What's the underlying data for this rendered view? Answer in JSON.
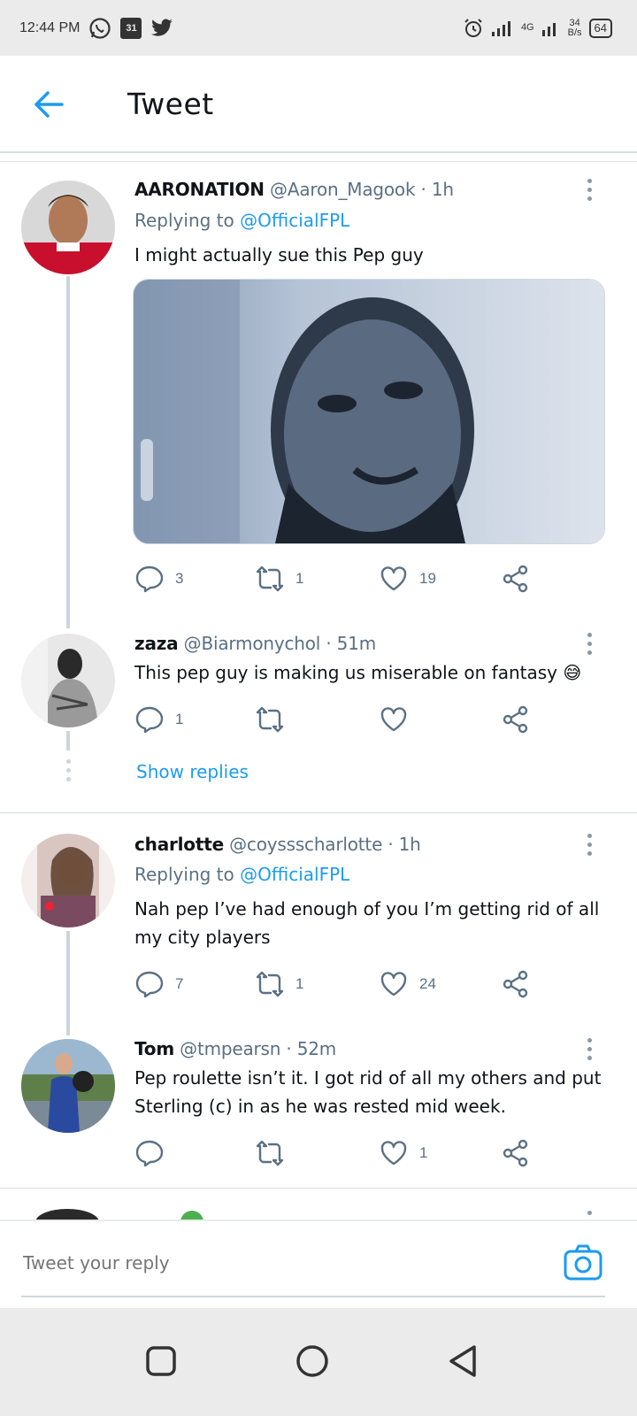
{
  "status_bar": {
    "time": "12:44 PM",
    "calendar_day": "31",
    "network_type": "4G",
    "speed_value": "34",
    "speed_unit": "B/s",
    "battery": "64",
    "icons": [
      "whatsapp-icon",
      "calendar-icon",
      "twitter-icon",
      "alarm-icon",
      "signal-icon",
      "battery-icon"
    ]
  },
  "header": {
    "title": "Tweet"
  },
  "tweets": [
    {
      "name": "AARONATION",
      "handle": "@Aaron_Magook",
      "time": "· 1h",
      "replying_label": "Replying to",
      "replying_to": "@OfficialFPL",
      "text": "I might actually sue this Pep guy",
      "replies": "3",
      "retweets": "1",
      "likes": "19"
    },
    {
      "name": "zaza",
      "handle": "@Biarmonychol",
      "time": "· 51m",
      "text": "This pep guy is making us miserable on fantasy 😅",
      "replies": "1",
      "retweets": "",
      "likes": ""
    },
    {
      "name": "charlotte",
      "handle": "@coyssscharlotte",
      "time": "· 1h",
      "replying_label": "Replying to",
      "replying_to": "@OfficialFPL",
      "text": "Nah pep I’ve had enough of you I’m getting rid of all my city players",
      "replies": "7",
      "retweets": "1",
      "likes": "24"
    },
    {
      "name": "Tom",
      "handle": "@tmpearsn",
      "time": "· 52m",
      "text": "Pep roulette isn’t it. I got rid of all my others and put Sterling (c) in as he was rested mid week.",
      "replies": "",
      "retweets": "",
      "likes": "1"
    }
  ],
  "show_replies": "Show replies",
  "reply_bar": {
    "placeholder": "Tweet your reply"
  },
  "colors": {
    "accent": "#1d9bf0",
    "text": "#0f1419",
    "secondary": "#5b7083",
    "divider": "#d6dde2"
  }
}
